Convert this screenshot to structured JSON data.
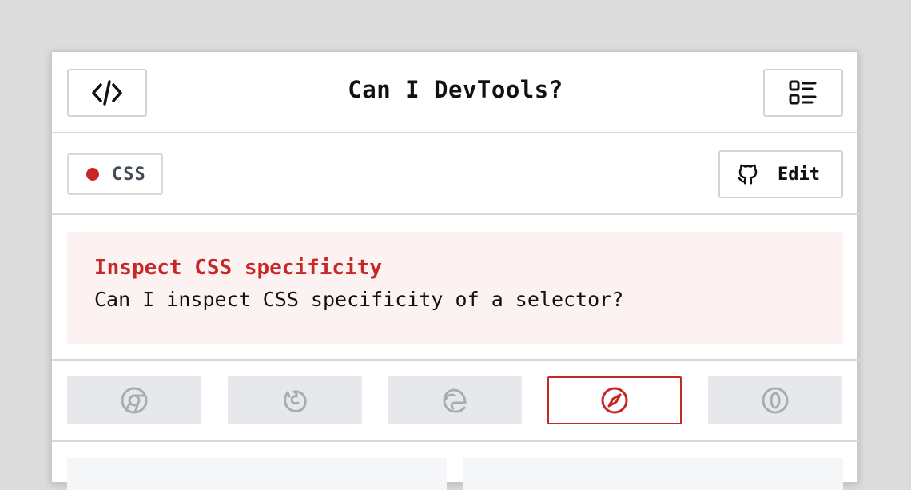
{
  "app": {
    "title": "Can I DevTools?"
  },
  "header": {
    "left_button_icon": "code-icon",
    "right_button_icon": "list-icon"
  },
  "tag": {
    "label": "CSS",
    "color": "#c62828"
  },
  "edit_button": {
    "label": "Edit",
    "icon": "github-icon"
  },
  "question": {
    "title": "Inspect CSS specificity",
    "text": "Can I inspect CSS specificity of a selector?"
  },
  "browsers": [
    {
      "name": "chrome",
      "icon": "chrome-icon",
      "active": false
    },
    {
      "name": "firefox",
      "icon": "firefox-icon",
      "active": false
    },
    {
      "name": "edge",
      "icon": "edge-icon",
      "active": false
    },
    {
      "name": "safari",
      "icon": "safari-icon",
      "active": true
    },
    {
      "name": "opera",
      "icon": "opera-icon",
      "active": false
    }
  ],
  "colors": {
    "accent": "#c62828",
    "inactive_icon": "#a9adb2",
    "inactive_bg": "#e6e8eb",
    "question_bg": "#fdf2f2"
  }
}
